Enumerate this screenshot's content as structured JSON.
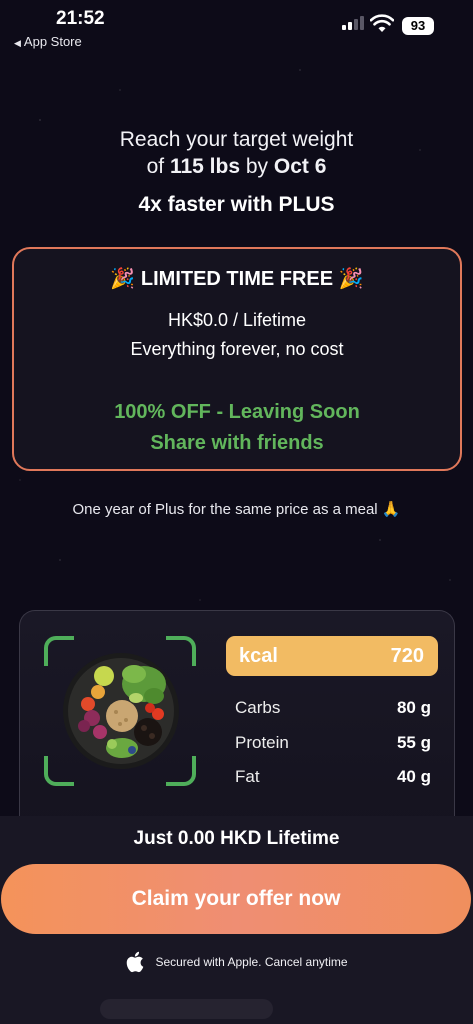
{
  "status_bar": {
    "time": "21:52",
    "back_label": "App Store",
    "battery": "93"
  },
  "heading": {
    "line1": "Reach your target weight",
    "line2_prefix": "of ",
    "target_weight": "115 lbs",
    "line2_mid": " by ",
    "target_date": "Oct 6",
    "subhead": "4x faster with PLUS"
  },
  "offer": {
    "title": "🎉 LIMITED TIME FREE 🎉",
    "price": "HK$0.0 / Lifetime",
    "description": "Everything forever, no cost",
    "discount": "100% OFF - Leaving Soon",
    "share": "Share with friends",
    "accent_color": "#e0785a",
    "green_color": "#62b65c"
  },
  "meal_line": "One year of Plus for the same price as a meal 🙏",
  "nutrition": {
    "kcal_label": "kcal",
    "kcal_value": "720",
    "kcal_color": "#f2bb63",
    "macros": [
      {
        "name": "Carbs",
        "value": "80 g"
      },
      {
        "name": "Protein",
        "value": "55 g"
      },
      {
        "name": "Fat",
        "value": "40 g"
      }
    ]
  },
  "footer": {
    "lifetime_text": "Just 0.00 HKD Lifetime",
    "claim_button": "Claim your offer now",
    "secured_text": "Secured with Apple. Cancel anytime"
  }
}
